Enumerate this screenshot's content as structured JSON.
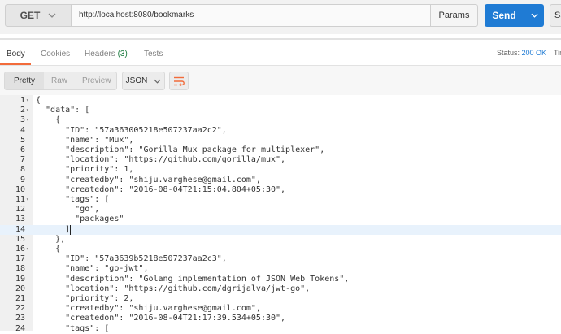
{
  "request": {
    "method": "GET",
    "url": "http://localhost:8080/bookmarks",
    "params_label": "Params",
    "send_label": "Send",
    "save_label": "Sa"
  },
  "response_tabs": {
    "body": "Body",
    "cookies": "Cookies",
    "headers": "Headers",
    "headers_count": "(3)",
    "tests": "Tests",
    "status_label": "Status:",
    "status_value": "200 OK",
    "time_label": "Tim"
  },
  "toolbar": {
    "view_modes": [
      "Pretty",
      "Raw",
      "Preview"
    ],
    "active_view": "Pretty",
    "format": "JSON"
  },
  "colors": {
    "send_button": "#1f7bd4",
    "active_tab_underline": "#f26b3a",
    "status_ok": "#1f7bd4",
    "headers_count": "#1a7a3e",
    "wrap_icon": "#f26b3a"
  },
  "editor": {
    "cursor_line": 14,
    "lines": [
      {
        "n": "1",
        "fold": true,
        "text": "{"
      },
      {
        "n": "2",
        "fold": true,
        "text": "  \"data\": ["
      },
      {
        "n": "3",
        "fold": true,
        "text": "    {"
      },
      {
        "n": "4",
        "fold": false,
        "text": "      \"ID\": \"57a363005218e507237aa2c2\","
      },
      {
        "n": "5",
        "fold": false,
        "text": "      \"name\": \"Mux\","
      },
      {
        "n": "6",
        "fold": false,
        "text": "      \"description\": \"Gorilla Mux package for multiplexer\","
      },
      {
        "n": "7",
        "fold": false,
        "text": "      \"location\": \"https://github.com/gorilla/mux\","
      },
      {
        "n": "8",
        "fold": false,
        "text": "      \"priority\": 1,"
      },
      {
        "n": "9",
        "fold": false,
        "text": "      \"createdby\": \"shiju.varghese@gmail.com\","
      },
      {
        "n": "10",
        "fold": false,
        "text": "      \"createdon\": \"2016-08-04T21:15:04.804+05:30\","
      },
      {
        "n": "11",
        "fold": true,
        "text": "      \"tags\": ["
      },
      {
        "n": "12",
        "fold": false,
        "text": "        \"go\","
      },
      {
        "n": "13",
        "fold": false,
        "text": "        \"packages\""
      },
      {
        "n": "14",
        "fold": false,
        "text": "      ]"
      },
      {
        "n": "15",
        "fold": false,
        "text": "    },"
      },
      {
        "n": "16",
        "fold": true,
        "text": "    {"
      },
      {
        "n": "17",
        "fold": false,
        "text": "      \"ID\": \"57a3639b5218e507237aa2c3\","
      },
      {
        "n": "18",
        "fold": false,
        "text": "      \"name\": \"go-jwt\","
      },
      {
        "n": "19",
        "fold": false,
        "text": "      \"description\": \"Golang implementation of JSON Web Tokens\","
      },
      {
        "n": "20",
        "fold": false,
        "text": "      \"location\": \"https://github.com/dgrijalva/jwt-go\","
      },
      {
        "n": "21",
        "fold": false,
        "text": "      \"priority\": 2,"
      },
      {
        "n": "22",
        "fold": false,
        "text": "      \"createdby\": \"shiju.varghese@gmail.com\","
      },
      {
        "n": "23",
        "fold": false,
        "text": "      \"createdon\": \"2016-08-04T21:17:39.534+05:30\","
      },
      {
        "n": "24",
        "fold": false,
        "text": "      \"tags\": ["
      }
    ]
  }
}
